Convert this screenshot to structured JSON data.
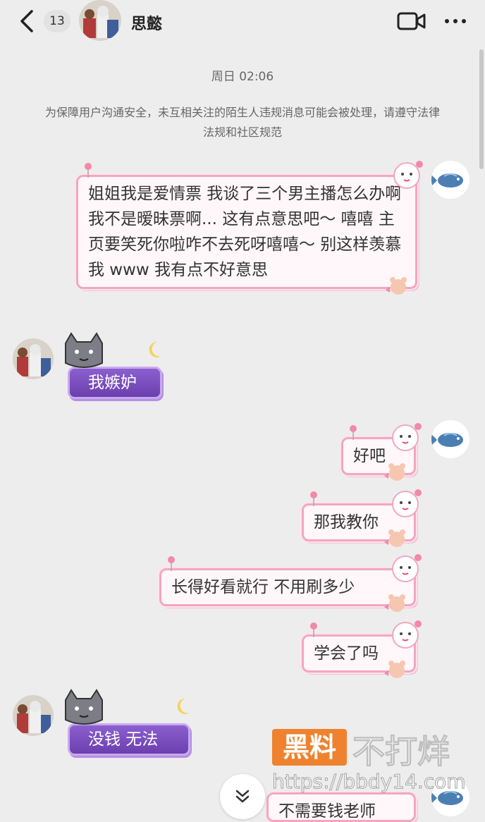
{
  "header": {
    "unread_count": "13",
    "contact_name": "思懿"
  },
  "chat": {
    "timestamp": "周日 02:06",
    "notice": "为保障用户沟通安全，未互相关注的陌生人违规消息可能会被处理，请遵守法律法规和社区规范",
    "messages": [
      {
        "side": "right",
        "text": "姐姐我是爱情票 我谈了三个男主播怎么办啊 我不是暧昧票啊... 这有点意思吧～ 嘻嘻 主页要笑死你啦咋不去死呀嘻嘻～ 别这样羡慕我 www 我有点不好意思"
      },
      {
        "side": "left",
        "text": "我嫉妒"
      },
      {
        "side": "right",
        "text": "好吧"
      },
      {
        "side": "right",
        "text": "那我教你"
      },
      {
        "side": "right",
        "text": "长得好看就行 不用刷多少"
      },
      {
        "side": "right",
        "text": "学会了吗"
      },
      {
        "side": "left",
        "text": "没钱  无法"
      },
      {
        "side": "right",
        "text": "不需要钱老师"
      }
    ]
  },
  "watermark": {
    "badge": "黑料",
    "text": "不打烊",
    "url": "https://bbdy14.com"
  },
  "colors": {
    "background": "#ededed",
    "pink_border": "#f2a7c0",
    "purple_bubble": "#7a4bbf",
    "watermark_orange": "#f07a1e"
  },
  "icons": [
    "back-arrow-icon",
    "video-call-icon",
    "more-icon",
    "scroll-down-icon",
    "fish-avatar-icon"
  ]
}
